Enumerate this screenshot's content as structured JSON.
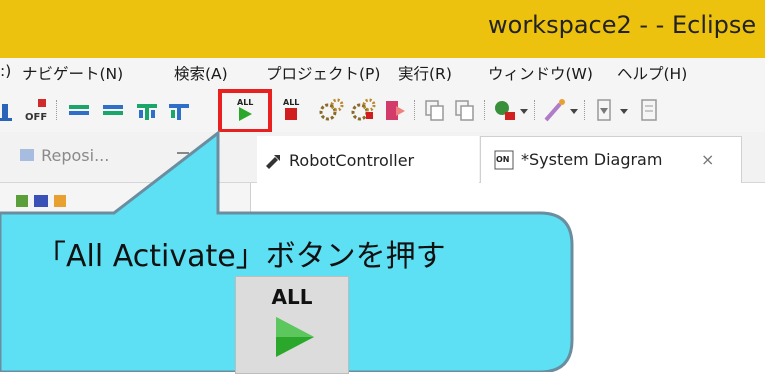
{
  "window": {
    "title": "workspace2 -  - Eclipse"
  },
  "menu": {
    "items": [
      ":)",
      "ナビゲート(N)",
      "検索(A)",
      "プロジェクト(P)",
      "実行(R)",
      "ウィンドウ(W)",
      "ヘルプ(H)"
    ]
  },
  "toolbar": {
    "all_label": "ALL",
    "off_label": "OFF",
    "icons": [
      "partial-icon",
      "deactivate-all-icon",
      "component-icon",
      "component-icon",
      "component-icon",
      "component-icon",
      "activate-all-icon",
      "stop-all-icon",
      "gear-icon",
      "gear-icon",
      "exit-icon",
      "copy-icon",
      "copy-icon",
      "run-icon",
      "dropdown-icon",
      "wand-icon",
      "dropdown-icon",
      "import-icon",
      "dropdown-icon",
      "view-icon"
    ]
  },
  "tabs": {
    "left": {
      "label": "Reposi..."
    },
    "items": [
      {
        "label": "RobotController"
      },
      {
        "label": "*System Diagram",
        "close": "×",
        "badge": "ON"
      }
    ]
  },
  "callout": {
    "text": "「All Activate」ボタンを押す",
    "icon_label": "ALL"
  },
  "colors": {
    "titlebar": "#ecc20e",
    "callout_fill": "#5de0f3",
    "highlight_border": "#e82020",
    "play_green": "#2ba82b"
  }
}
